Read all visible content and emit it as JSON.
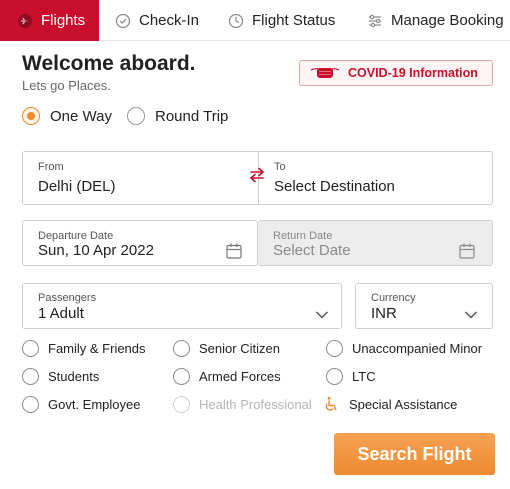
{
  "tabs": [
    {
      "label": "Flights",
      "icon": "plane-icon",
      "active": true
    },
    {
      "label": "Check-In",
      "icon": "check-circle-icon",
      "active": false
    },
    {
      "label": "Flight Status",
      "icon": "clock-icon",
      "active": false
    },
    {
      "label": "Manage Booking",
      "icon": "sliders-icon",
      "active": false
    }
  ],
  "header": {
    "title": "Welcome aboard.",
    "subtitle": "Lets go Places."
  },
  "covid_link": {
    "label": "COVID-19 Information",
    "icon": "mask-icon"
  },
  "trip_type": {
    "one_way": "One Way",
    "round_trip": "Round Trip",
    "selected": "One Way"
  },
  "route": {
    "from_label": "From",
    "from_value": "Delhi (DEL)",
    "to_label": "To",
    "to_value": "Select Destination"
  },
  "dates": {
    "departure_label": "Departure Date",
    "departure_value": "Sun, 10 Apr 2022",
    "return_label": "Return Date",
    "return_value": "Select Date"
  },
  "passengers": {
    "label": "Passengers",
    "value": "1 Adult"
  },
  "currency": {
    "label": "Currency",
    "value": "INR"
  },
  "special_fares": [
    {
      "label": "Family & Friends",
      "enabled": true
    },
    {
      "label": "Senior Citizen",
      "enabled": true
    },
    {
      "label": "Unaccompanied Minor",
      "enabled": true
    },
    {
      "label": "Students",
      "enabled": true
    },
    {
      "label": "Armed Forces",
      "enabled": true
    },
    {
      "label": "LTC",
      "enabled": true
    },
    {
      "label": "Govt. Employee",
      "enabled": true
    },
    {
      "label": "Health Professional",
      "enabled": false
    },
    {
      "label": "Special Assistance",
      "enabled": true,
      "icon": "wheelchair-icon"
    }
  ],
  "search_button": "Search Flight",
  "colors": {
    "brand_red": "#c8102e",
    "accent_orange": "#ef8a30"
  }
}
